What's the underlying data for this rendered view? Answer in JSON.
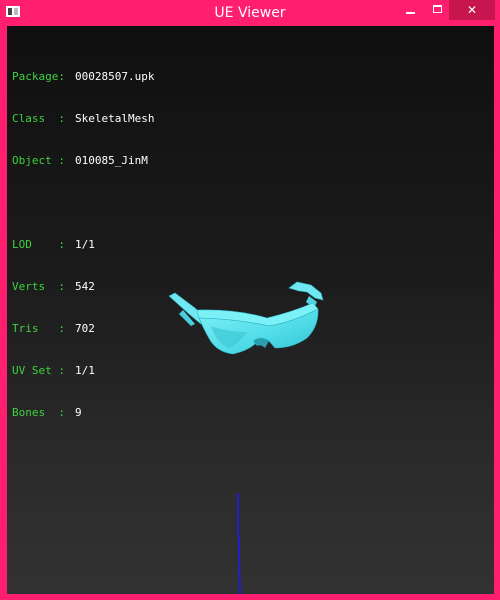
{
  "window": {
    "title": "UE Viewer",
    "controls": {
      "minimize": "minimize",
      "maximize": "maximize",
      "close": "✕"
    }
  },
  "info": {
    "rows_top": [
      {
        "label": "Package:",
        "value": "00028507.upk"
      },
      {
        "label": "Class  :",
        "value": "SkeletalMesh"
      },
      {
        "label": "Object :",
        "value": "010085_JinM"
      }
    ],
    "rows_bottom": [
      {
        "label": "LOD    :",
        "value": "1/1"
      },
      {
        "label": "Verts  :",
        "value": "542"
      },
      {
        "label": "Tris   :",
        "value": "702"
      },
      {
        "label": "UV Set :",
        "value": "1/1"
      },
      {
        "label": "Bones  :",
        "value": "9"
      }
    ]
  },
  "colors": {
    "frame": "#ff1f6e",
    "label_green": "#3ed13e",
    "mesh_cyan": "#5ee3ee",
    "axis_blue": "#1a1aff"
  },
  "mesh": {
    "icon": "sunglasses-mesh"
  }
}
